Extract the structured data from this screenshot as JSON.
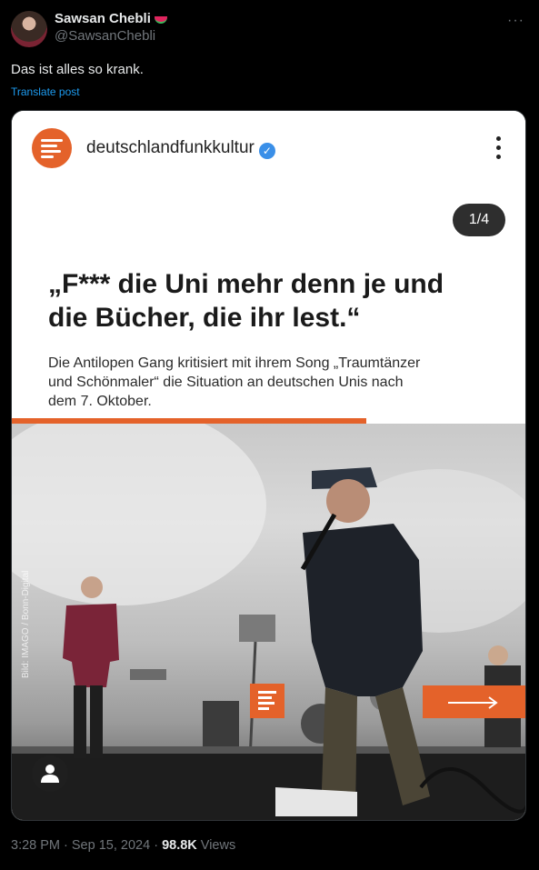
{
  "tweet": {
    "author_name": "Sawsan Chebli",
    "author_handle": "@SawsanChebli",
    "text": "Das ist alles so krank.",
    "translate_label": "Translate post",
    "time": "3:28 PM",
    "date": "Sep 15, 2024",
    "views_count": "98.8K",
    "views_label": "Views",
    "more_icon": "more-horizontal-icon",
    "name_emoji": "watermelon-icon"
  },
  "embed": {
    "account_name": "deutschlandfunkkultur",
    "verified_icon": "verified-check-icon",
    "menu_icon": "kebab-menu-icon",
    "slide_counter": "1/4",
    "headline": "„F*** die Uni mehr denn je und die Bücher, die ihr lest.“",
    "subline": "Die Antilopen Gang kritisiert mit ihrem Song „Traumtänzer und Schönmaler“ die Situation an deutschen Unis nach dem 7. Oktober.",
    "photo_credit": "Bild: IMAGO / Bonn-Digital",
    "brand_color": "#e4622a",
    "next_icon": "arrow-right-icon",
    "user_tag_icon": "user-tag-icon"
  }
}
